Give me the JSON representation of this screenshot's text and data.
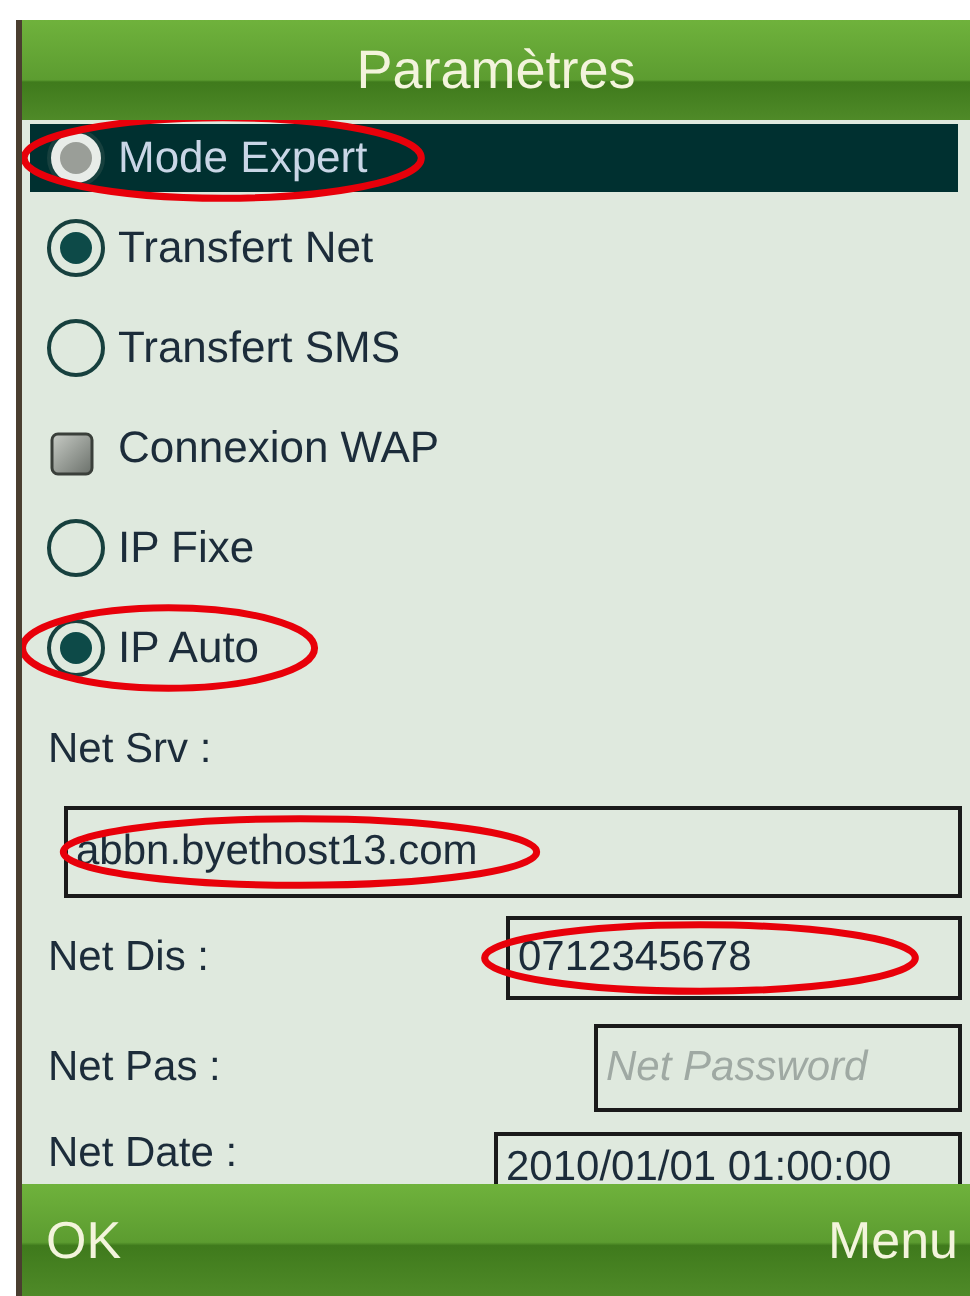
{
  "title": "Paramètres",
  "options": [
    {
      "kind": "radio",
      "label": "Mode Expert",
      "checked": true,
      "selected": true,
      "circled": true
    },
    {
      "kind": "radio",
      "label": "Transfert Net",
      "checked": true,
      "selected": false,
      "circled": false
    },
    {
      "kind": "radio",
      "label": "Transfert SMS",
      "checked": false,
      "selected": false,
      "circled": false
    },
    {
      "kind": "checkbox",
      "label": "Connexion WAP",
      "checked": false,
      "selected": false,
      "circled": false
    },
    {
      "kind": "radio",
      "label": "IP Fixe",
      "checked": false,
      "selected": false,
      "circled": false
    },
    {
      "kind": "radio",
      "label": "IP Auto",
      "checked": true,
      "selected": false,
      "circled": true
    }
  ],
  "fields": [
    {
      "label": "Net Srv :",
      "value": "abbn.byethost13.com",
      "circled": true
    },
    {
      "label": "Net Dis :",
      "value": "0712345678",
      "circled": true
    },
    {
      "label": "Net Pas :",
      "placeholder": "Net Password",
      "circled": false
    },
    {
      "label": "Net Date :",
      "value": "2010/01/01 01:00:00",
      "circled": false
    }
  ],
  "softkeys": {
    "left": "OK",
    "right": "Menu"
  }
}
